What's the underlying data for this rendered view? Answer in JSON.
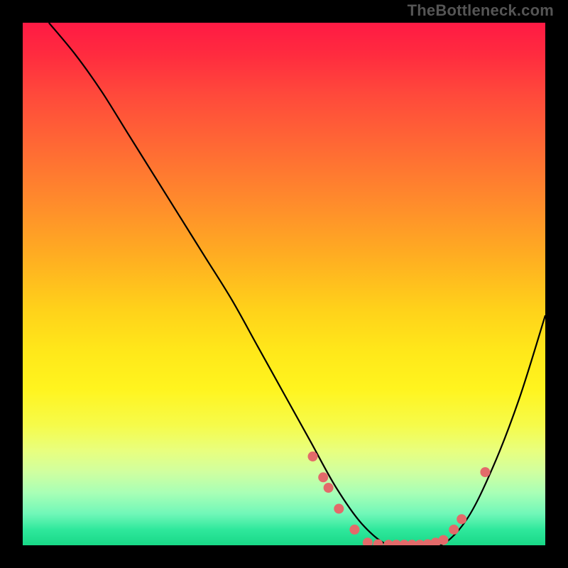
{
  "attribution": "TheBottleneck.com",
  "chart_data": {
    "type": "line",
    "title": "",
    "xlabel": "",
    "ylabel": "",
    "xlim": [
      0,
      100
    ],
    "ylim": [
      0,
      100
    ],
    "series": [
      {
        "name": "curve",
        "x": [
          5,
          10,
          15,
          20,
          25,
          30,
          35,
          40,
          45,
          50,
          55,
          60,
          65,
          70,
          75,
          80,
          85,
          90,
          95,
          100
        ],
        "y": [
          100,
          94,
          87,
          79,
          71,
          63,
          55,
          47,
          38,
          29,
          20,
          11,
          4,
          0,
          0,
          0,
          5,
          15,
          28,
          44
        ]
      }
    ],
    "markers": [
      {
        "x": 55.5,
        "y": 17
      },
      {
        "x": 57.5,
        "y": 13
      },
      {
        "x": 58.5,
        "y": 11
      },
      {
        "x": 60.5,
        "y": 7
      },
      {
        "x": 63.5,
        "y": 3
      },
      {
        "x": 66.0,
        "y": 0.5
      },
      {
        "x": 68.0,
        "y": 0.2
      },
      {
        "x": 70.0,
        "y": 0.1
      },
      {
        "x": 71.5,
        "y": 0.1
      },
      {
        "x": 73.0,
        "y": 0.1
      },
      {
        "x": 74.5,
        "y": 0.1
      },
      {
        "x": 76.0,
        "y": 0.1
      },
      {
        "x": 77.5,
        "y": 0.2
      },
      {
        "x": 79.0,
        "y": 0.5
      },
      {
        "x": 80.5,
        "y": 1.0
      },
      {
        "x": 82.5,
        "y": 3.0
      },
      {
        "x": 84.0,
        "y": 5.0
      },
      {
        "x": 88.5,
        "y": 14.0
      }
    ],
    "marker_color": "#e36a6a",
    "curve_color": "#000000",
    "gradient_stops": [
      {
        "pos": 0,
        "color": "#ff1a44"
      },
      {
        "pos": 50,
        "color": "#ffd21a"
      },
      {
        "pos": 100,
        "color": "#18d887"
      }
    ]
  }
}
